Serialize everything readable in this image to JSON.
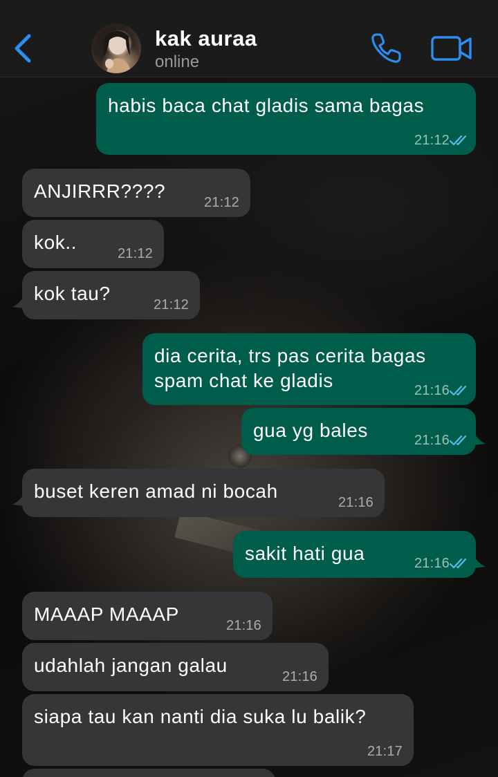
{
  "header": {
    "contact_name": "kak auraa",
    "status": "online",
    "icons": {
      "back": "chevron-left-icon",
      "call": "phone-icon",
      "video": "video-camera-icon"
    },
    "accent_color": "#2b8ef0"
  },
  "messages": [
    {
      "direction": "out",
      "text": "habis baca chat gladis sama bagas",
      "time": "21:12",
      "read": true
    },
    {
      "direction": "in",
      "text": "ANJIRRR????",
      "time": "21:12"
    },
    {
      "direction": "in",
      "text": "kok..",
      "time": "21:12"
    },
    {
      "direction": "in",
      "text": "kok tau?",
      "time": "21:12"
    },
    {
      "direction": "out",
      "text": "dia cerita, trs pas cerita bagas spam chat ke gladis",
      "time": "21:16",
      "read": true
    },
    {
      "direction": "out",
      "text": "gua yg bales",
      "time": "21:16",
      "read": true
    },
    {
      "direction": "in",
      "text": "buset keren amad ni bocah",
      "time": "21:16"
    },
    {
      "direction": "out",
      "text": "sakit hati gua",
      "time": "21:16",
      "read": true
    },
    {
      "direction": "in",
      "text": "MAAAP MAAAP",
      "time": "21:16"
    },
    {
      "direction": "in",
      "text": "udahlah jangan galau",
      "time": "21:16"
    },
    {
      "direction": "in",
      "text": "siapa tau kan nanti dia suka lu balik?",
      "time": "21:17"
    }
  ],
  "colors": {
    "outgoing_bubble": "#005c4b",
    "incoming_bubble": "#363638",
    "read_ticks": "#53bdeb",
    "header_bg": "#1b1b1b"
  }
}
